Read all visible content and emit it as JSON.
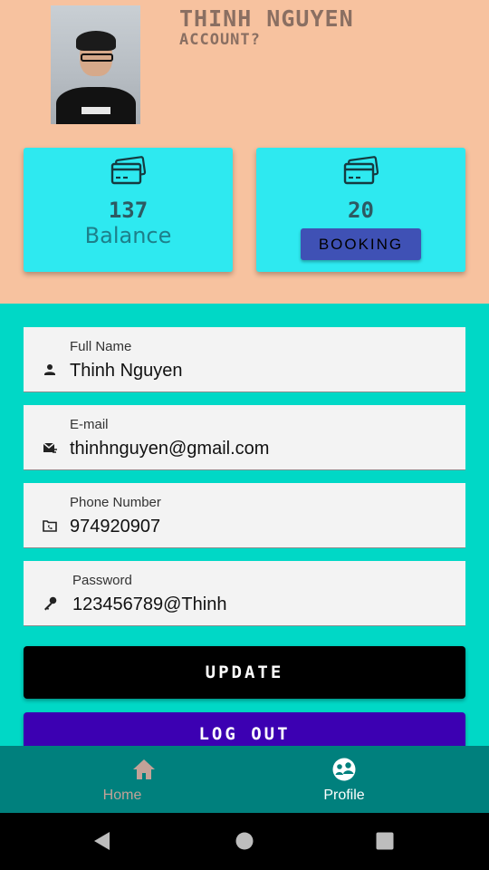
{
  "profile": {
    "name": "THINH NGUYEN",
    "subtitle": "ACCOUNT?"
  },
  "cards": {
    "balance": {
      "value": "137",
      "label": "Balance",
      "icon": "credit-cards-icon"
    },
    "booking": {
      "value": "20",
      "button_label": "BOOKING",
      "icon": "credit-cards-icon"
    }
  },
  "form": {
    "full_name": {
      "label": "Full Name",
      "value": "Thinh Nguyen",
      "icon": "person-icon"
    },
    "email": {
      "label": "E-mail",
      "value": "thinhnguyen@gmail.com",
      "icon": "mail-icon"
    },
    "phone": {
      "label": "Phone Number",
      "value": "974920907",
      "icon": "phone-icon"
    },
    "password": {
      "label": "Password",
      "value": "123456789@Thinh",
      "icon": "key-icon"
    }
  },
  "buttons": {
    "update": "UPDATE",
    "logout": "LOG OUT"
  },
  "bottom_nav": {
    "items": [
      {
        "label": "Home",
        "icon": "home-icon",
        "active": false
      },
      {
        "label": "Profile",
        "icon": "profile-icon",
        "active": true
      }
    ]
  },
  "colors": {
    "header_bg": "#f7c29f",
    "body_bg": "#00d8c6",
    "card_bg": "#2ee9f0",
    "booking_button": "#3f51b5",
    "update_button": "#000000",
    "logout_button": "#3c00b2",
    "bottom_nav_bg": "#00807d"
  }
}
